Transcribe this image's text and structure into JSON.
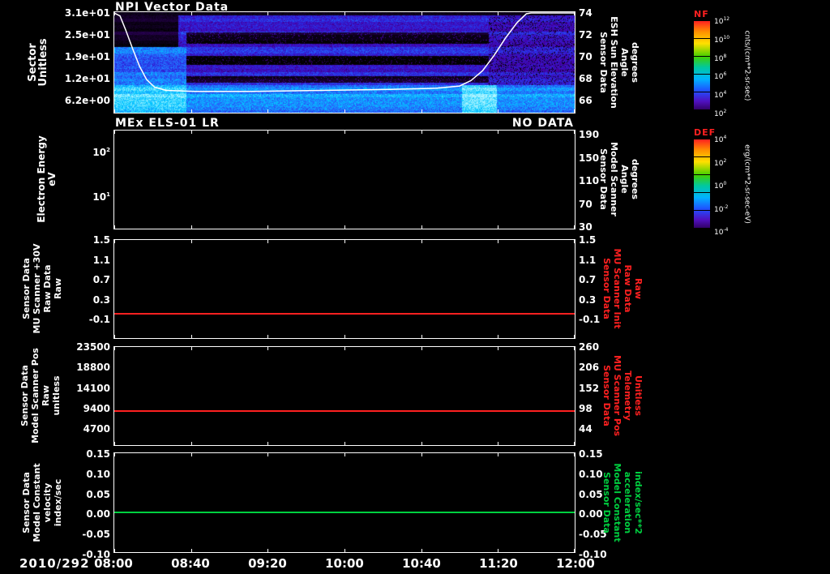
{
  "meta": {
    "background": "#000000",
    "foreground": "#ffffff",
    "accent_red": "#ff2020",
    "accent_green": "#00d040"
  },
  "titles": {
    "panel1": "NPI Vector Data",
    "panel2_left": "MEx ELS-01 LR",
    "panel2_right": "NO DATA"
  },
  "xaxis": {
    "date": "2010/292",
    "ticks": [
      "08:00",
      "08:40",
      "09:20",
      "10:00",
      "10:40",
      "11:20",
      "12:00"
    ]
  },
  "panels": [
    {
      "name": "npi",
      "left_label": "Sector\nUnitless",
      "left_ticks": [
        "3.1e+01",
        "2.5e+01",
        "1.9e+01",
        "1.2e+01",
        "6.2e+00"
      ],
      "right_label": "Sensor Data\nESH Sun Elevation\nAngle\ndegrees",
      "right_ticks": [
        "74",
        "72",
        "70",
        "68",
        "66"
      ]
    },
    {
      "name": "els",
      "left_label": "Electron Energy\neV",
      "left_ticks": [
        "10^2",
        "10^1"
      ],
      "right_label": "Sensor Data\nModel Scanner\nAngle\ndegrees",
      "right_ticks": [
        "190",
        "150",
        "110",
        "70",
        "30"
      ]
    },
    {
      "name": "mu-scanner-30v",
      "left_label": "Sensor Data\nMU Scanner +30V\nRaw Data\nRaw",
      "left_ticks": [
        "1.5",
        "1.1",
        "0.7",
        "0.3",
        "-0.1"
      ],
      "right_label": "Sensor Data\nMU Scanner Init\nRaw Data\nRaw",
      "right_ticks": [
        "1.5",
        "1.1",
        "0.7",
        "0.3",
        "-0.1"
      ]
    },
    {
      "name": "model-scanner-pos",
      "left_label": "Sensor Data\nModel Scanner Pos\nRaw\nunitless",
      "left_ticks": [
        "23500",
        "18800",
        "14100",
        "9400",
        "4700"
      ],
      "right_label": "Sensor Data\nMU Scanner Pos\nTelemetry\nUnitless",
      "right_ticks": [
        "260",
        "206",
        "152",
        "98",
        "44"
      ]
    },
    {
      "name": "model-constant-velocity",
      "left_label": "Sensor Data\nModel Constant\nvelocity\nindex/sec",
      "left_ticks": [
        "0.15",
        "0.10",
        "0.05",
        "0.00",
        "-0.05",
        "-0.10"
      ],
      "right_label": "Sensor Data\nModel Constant\nacceleration\nindex/sec**2",
      "right_ticks": [
        "0.15",
        "0.10",
        "0.05",
        "0.00",
        "-0.05",
        "-0.10"
      ]
    }
  ],
  "colorbars": [
    {
      "name": "NF",
      "unit": "cnts/(cm**2-sr-sec)",
      "ticks": [
        "10^12",
        "10^10",
        "10^8",
        "10^6",
        "10^4",
        "10^2"
      ]
    },
    {
      "name": "DEF",
      "unit": "erg/(cm**2-sr-sec-eV)",
      "ticks": [
        "10^4",
        "10^2",
        "10^0",
        "10^-2",
        "10^-4"
      ]
    }
  ],
  "chart_data": [
    {
      "type": "heatmap",
      "title": "NPI Vector Data",
      "colorbar": "NF",
      "unit": "cnts/(cm**2-sr-sec)",
      "x_start_hour": 8,
      "x_end_hour": 12,
      "x_tick_labels": [
        "08:00",
        "08:40",
        "09:20",
        "10:00",
        "10:40",
        "11:20",
        "12:00"
      ],
      "rows": 32,
      "ylabel": "Sector (Unitless)",
      "y_tick_values": [
        31,
        25,
        19,
        12,
        6.2
      ],
      "dark_bands_frac": [
        [
          0.2,
          0.31
        ],
        [
          0.43,
          0.52
        ],
        [
          0.63,
          0.7
        ]
      ],
      "bright_bottom_frac": 0.72,
      "band_region_t": [
        8.62,
        11.25
      ],
      "bright_blob_t": [
        11.02,
        11.32
      ],
      "palette": [
        [
          0,
          "#000000"
        ],
        [
          0.18,
          "#24004a"
        ],
        [
          0.35,
          "#4600a8"
        ],
        [
          0.5,
          "#2a28e0"
        ],
        [
          0.65,
          "#2472ff"
        ],
        [
          0.8,
          "#00c8ff"
        ],
        [
          1,
          "#b0f4ff"
        ]
      ],
      "overlay_line": {
        "name": "ESH Sun Elevation Angle (degrees)",
        "axis_ticks": [
          74,
          72,
          70,
          68,
          66
        ],
        "points": [
          [
            8.0,
            74.2
          ],
          [
            8.05,
            73.8
          ],
          [
            8.1,
            72.5
          ],
          [
            8.16,
            70.8
          ],
          [
            8.22,
            69.2
          ],
          [
            8.28,
            68.0
          ],
          [
            8.35,
            67.3
          ],
          [
            8.45,
            67.0
          ],
          [
            8.7,
            66.9
          ],
          [
            9.2,
            66.9
          ],
          [
            9.8,
            67.0
          ],
          [
            10.4,
            67.1
          ],
          [
            10.8,
            67.2
          ],
          [
            11.0,
            67.4
          ],
          [
            11.1,
            67.9
          ],
          [
            11.2,
            68.8
          ],
          [
            11.3,
            70.2
          ],
          [
            11.4,
            71.8
          ],
          [
            11.5,
            73.2
          ],
          [
            11.58,
            74.0
          ],
          [
            11.62,
            74.2
          ],
          [
            12.0,
            74.2
          ]
        ]
      }
    },
    {
      "type": "heatmap",
      "title": "MEx ELS-01 LR",
      "status": "NO DATA",
      "colorbar": "DEF",
      "unit": "erg/(cm**2-sr-sec-eV)",
      "ylabel": "Electron Energy (eV)",
      "yscale": "log",
      "y_tick_values": [
        100,
        10
      ],
      "right_axis_label": "Model Scanner Angle (degrees)",
      "right_axis_ticks": [
        190,
        150,
        110,
        70,
        30
      ],
      "series": []
    },
    {
      "type": "line",
      "ylabel": "MU Scanner +30V Raw Data (Raw)",
      "ylim": [
        -0.5,
        1.5
      ],
      "y_tick_values": [
        1.5,
        1.1,
        0.7,
        0.3,
        -0.1
      ],
      "series": [
        {
          "name": "MU Scanner +30V Raw",
          "color": "#ff2020",
          "constant_value": 0.0
        }
      ]
    },
    {
      "type": "line",
      "ylabel": "Model Scanner Pos Raw (unitless)",
      "ylim": [
        0,
        23500
      ],
      "y_tick_values": [
        23500,
        18800,
        14100,
        9400,
        4700
      ],
      "right_ylim": [
        0,
        260
      ],
      "right_tick_values": [
        260,
        206,
        152,
        98,
        44
      ],
      "series": [
        {
          "name": "MU Scanner Pos Telemetry",
          "color": "#ff2020",
          "constant_value": 8200
        }
      ]
    },
    {
      "type": "line",
      "ylabel": "Model Constant velocity (index/sec)",
      "ylim": [
        -0.1,
        0.15
      ],
      "y_tick_values": [
        0.15,
        0.1,
        0.05,
        0.0,
        -0.05,
        -0.1
      ],
      "series": [
        {
          "name": "Model Constant acceleration",
          "color": "#00d040",
          "constant_value": 0.0
        }
      ]
    }
  ]
}
